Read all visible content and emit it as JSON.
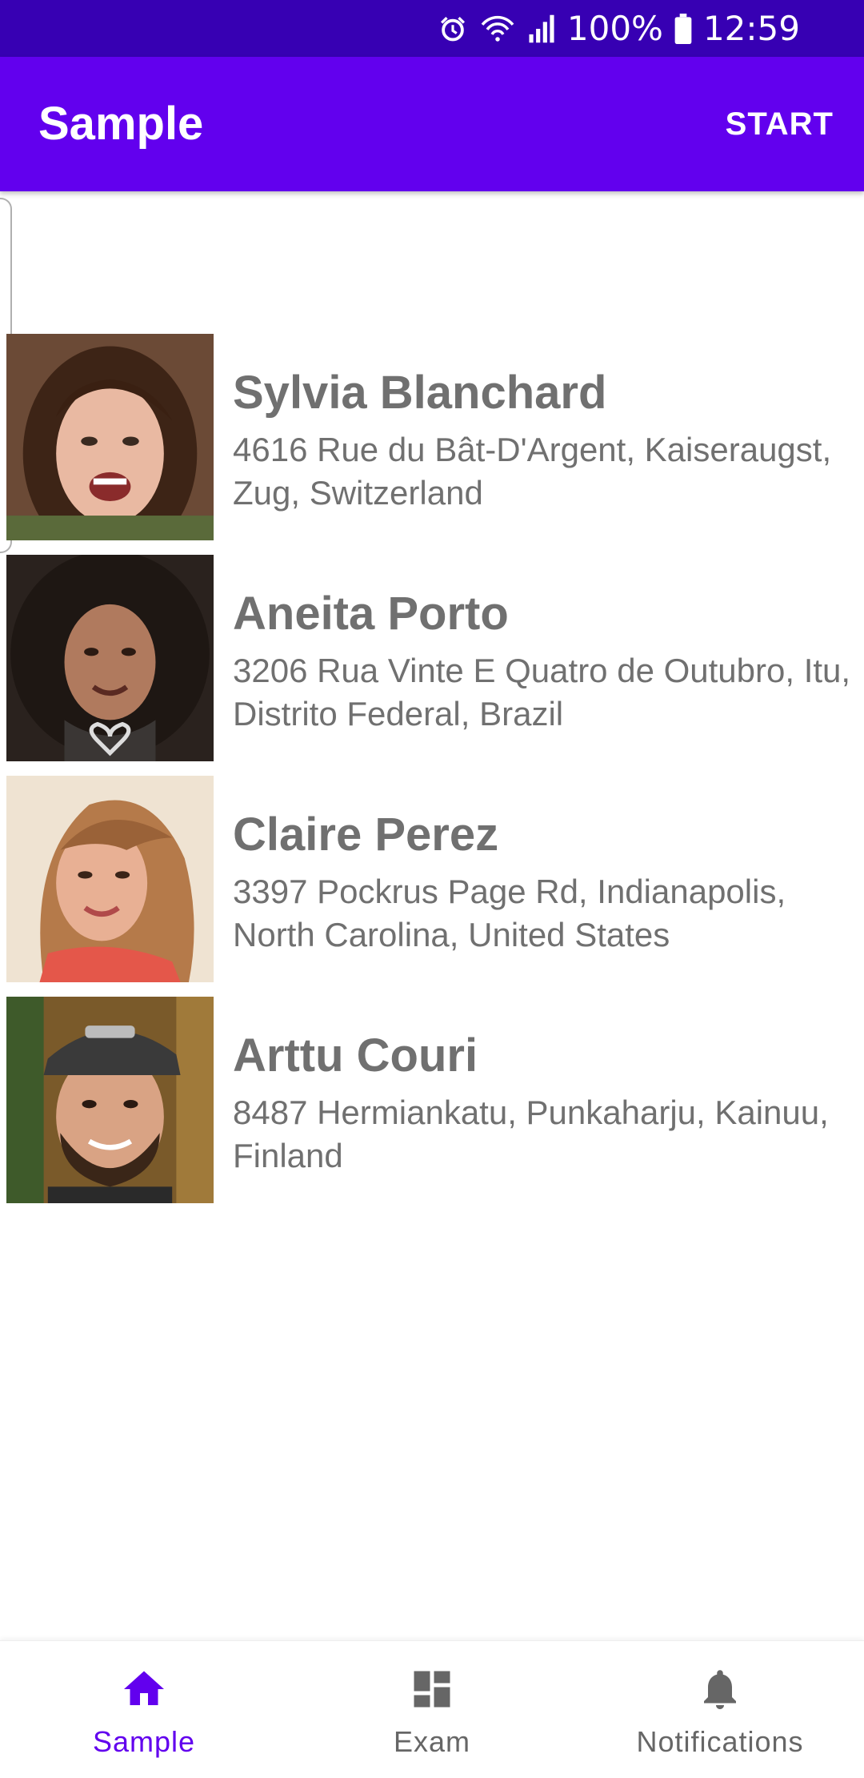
{
  "status_bar": {
    "battery": "100%",
    "time": "12:59",
    "icons": [
      "alarm-icon",
      "wifi-icon",
      "signal-icon",
      "battery-icon"
    ]
  },
  "app_bar": {
    "title": "Sample",
    "action_label": "START"
  },
  "contacts": [
    {
      "name": "Sylvia Blanchard",
      "address": "4616 Rue du Bât-D'Argent, Kaiseraugst, Zug, Switzerland"
    },
    {
      "name": "Aneita Porto",
      "address": "3206 Rua Vinte E Quatro de Outubro, Itu, Distrito Federal, Brazil"
    },
    {
      "name": "Claire Perez",
      "address": "3397 Pockrus Page Rd, Indianapolis, North Carolina, United States"
    },
    {
      "name": "Arttu Couri",
      "address": "8487 Hermiankatu, Punkaharju, Kainuu, Finland"
    }
  ],
  "bottom_nav": {
    "items": [
      {
        "label": "Sample",
        "icon": "home-icon",
        "active": true
      },
      {
        "label": "Exam",
        "icon": "dashboard-icon",
        "active": false
      },
      {
        "label": "Notifications",
        "icon": "bell-icon",
        "active": false
      }
    ]
  },
  "colors": {
    "status_bar": "#3700b3",
    "app_bar": "#6200ee",
    "accent": "#6200ee",
    "text_secondary": "#707070"
  }
}
